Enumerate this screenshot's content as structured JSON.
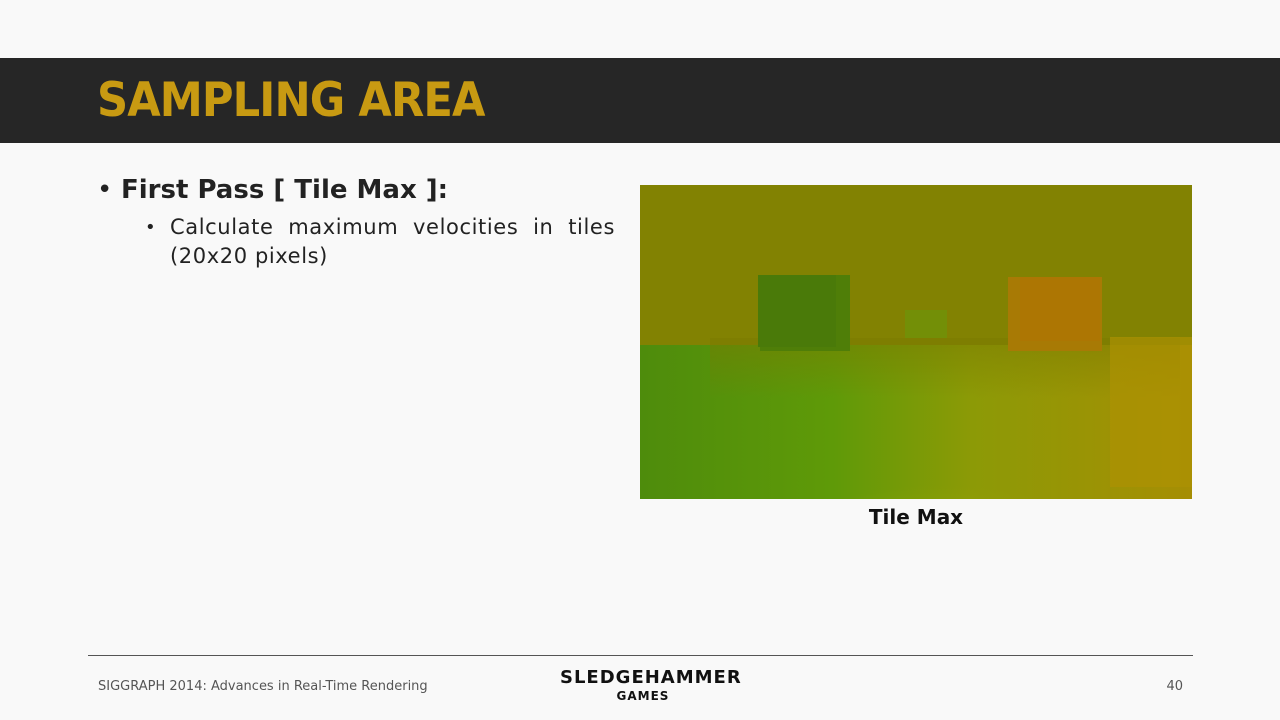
{
  "slide": {
    "title": "SAMPLING AREA",
    "bullets": {
      "level1": "First Pass [ Tile Max ]:",
      "level2": "Calculate maximum velocities in tiles (20x20 pixels)"
    },
    "figure_caption": "Tile Max"
  },
  "footer": {
    "conference": "SIGGRAPH 2014: Advances in Real-Time Rendering",
    "logo_line1": "SLEDGEHAMMER",
    "logo_line2": "GAMES",
    "page_number": "40"
  },
  "colors": {
    "title_bar": "#262626",
    "title_text": "#c89a12",
    "background": "#f9f9f9"
  }
}
